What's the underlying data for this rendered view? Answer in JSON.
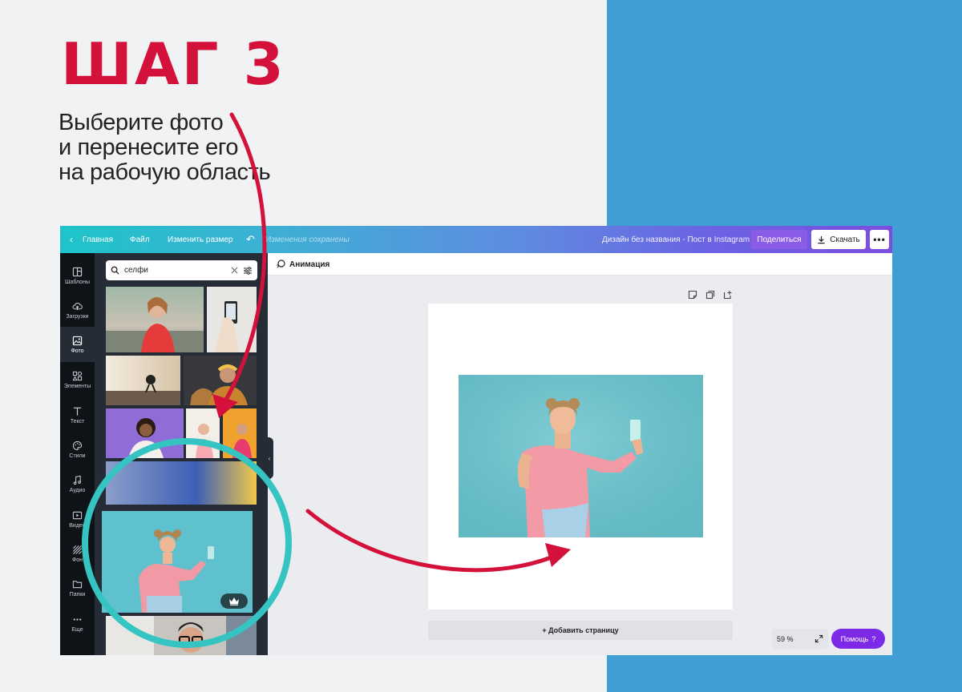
{
  "step": {
    "title": "ШАГ 3",
    "lines": [
      "Выберите фото",
      "и перенесите его",
      "на рабочую область"
    ]
  },
  "colors": {
    "accent": "#d4113b",
    "blue_panel": "#3f9ed3",
    "purple": "#7d2ae8",
    "magnifier": "#35c4c1"
  },
  "app": {
    "topbar": {
      "back_icon": "chevron-left-icon",
      "home": "Главная",
      "file": "Файл",
      "resize": "Изменить размер",
      "undo_icon": "undo-icon",
      "saved": "Изменения сохранены",
      "design_name": "Дизайн без названия - Пост в Instagram",
      "share": "Поделиться",
      "download": "Скачать",
      "more": "•••"
    },
    "sidebar": [
      {
        "label": "Шаблоны",
        "icon": "templates-icon"
      },
      {
        "label": "Загрузки",
        "icon": "upload-cloud-icon"
      },
      {
        "label": "Фото",
        "icon": "photo-icon",
        "active": true
      },
      {
        "label": "Элементы",
        "icon": "shapes-icon"
      },
      {
        "label": "Текст",
        "icon": "text-icon"
      },
      {
        "label": "Стили",
        "icon": "palette-icon"
      },
      {
        "label": "Аудио",
        "icon": "music-note-icon"
      },
      {
        "label": "Видео",
        "icon": "video-icon"
      },
      {
        "label": "Фон",
        "icon": "pattern-icon"
      },
      {
        "label": "Папки",
        "icon": "folder-icon"
      },
      {
        "label": "Еще",
        "icon": "more-dots-icon"
      }
    ],
    "search": {
      "value": "селфи",
      "icon": "search-icon",
      "clear_icon": "close-icon",
      "filter_icon": "filter-icon"
    },
    "toolbar": {
      "animation": "Анимация"
    },
    "add_page": "+ Добавить страницу",
    "zoom": "59 %",
    "help": "Помощь",
    "help_suffix": "?"
  }
}
